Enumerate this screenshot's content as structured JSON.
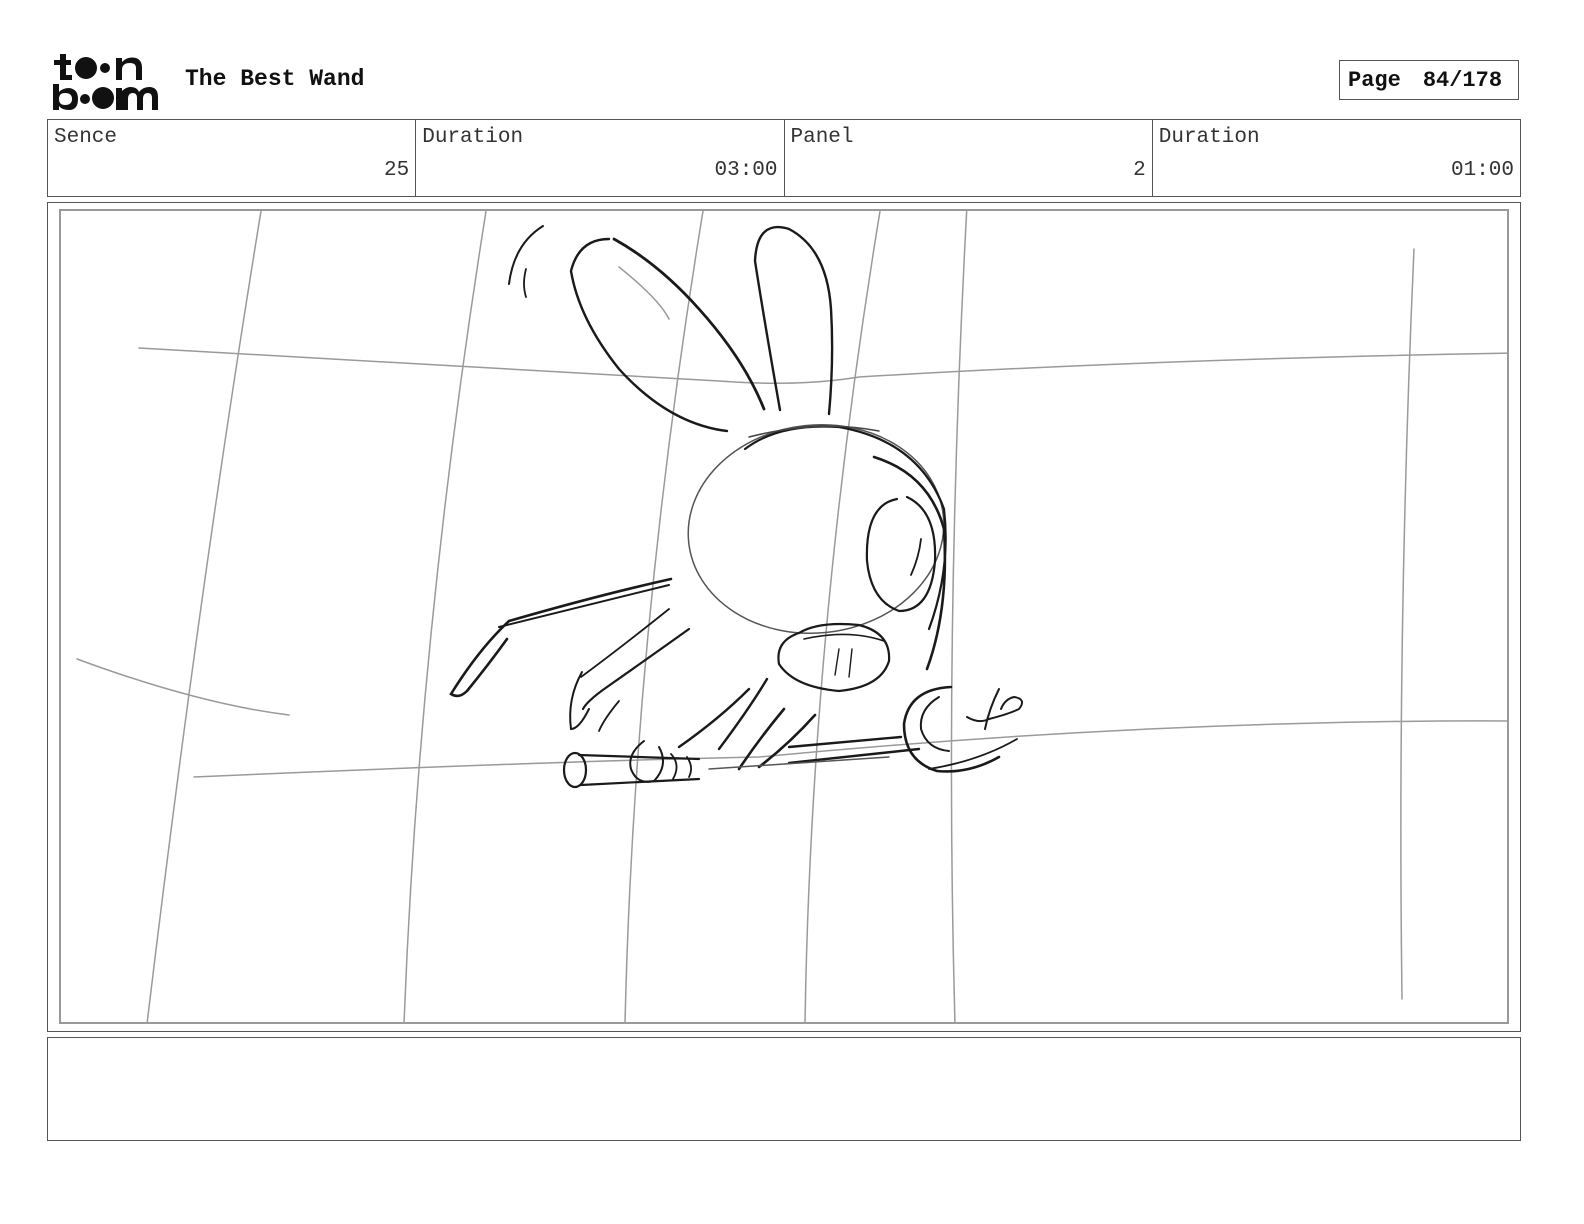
{
  "header": {
    "logo_line1": "toon",
    "logo_line2": "boom",
    "project_title": "The Best Wand",
    "page_label": "Page",
    "page_number": "84/178"
  },
  "info": {
    "scene_label": "Sence",
    "scene_value": "25",
    "scene_duration_label": "Duration",
    "scene_duration_value": "03:00",
    "panel_label": "Panel",
    "panel_value": "2",
    "panel_duration_label": "Duration",
    "panel_duration_value": "01:00"
  },
  "notes": {
    "text": ""
  }
}
